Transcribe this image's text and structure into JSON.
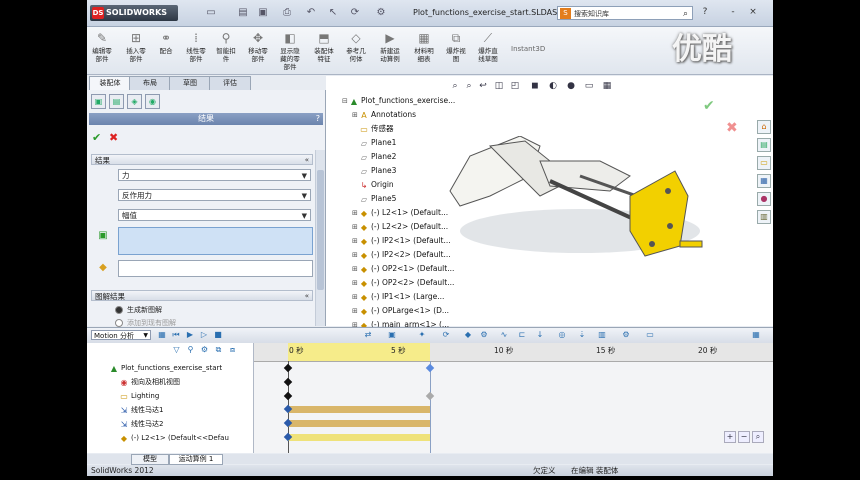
{
  "titlebar": {
    "logo": "SOLIDWORKS",
    "doc_title": "Plot_functions_exercise_start.SLDASM *",
    "search_placeholder": "搜索知识库",
    "help": "?",
    "minimize": "-",
    "close": "×"
  },
  "ribbon": {
    "items": [
      {
        "label": "编辑零部件",
        "icon": "edit-part-icon"
      },
      {
        "label": "插入零部件",
        "icon": "insert-part-icon"
      },
      {
        "label": "配合",
        "icon": "mate-icon"
      },
      {
        "label": "线性零部件",
        "icon": "linear-pattern-icon"
      },
      {
        "label": "智能扣件",
        "icon": "smart-fastener-icon"
      },
      {
        "label": "移动零部件",
        "icon": "move-part-icon"
      },
      {
        "label": "显示隐藏的零部件",
        "icon": "show-hidden-icon"
      },
      {
        "label": "装配体特征",
        "icon": "assembly-feature-icon"
      },
      {
        "label": "参考几何体",
        "icon": "reference-geometry-icon"
      },
      {
        "label": "新建运动算例",
        "icon": "new-motion-study-icon"
      },
      {
        "label": "材料明细表",
        "icon": "bom-icon"
      },
      {
        "label": "爆炸视图",
        "icon": "exploded-view-icon"
      },
      {
        "label": "爆炸直线草图",
        "icon": "explode-line-icon"
      }
    ],
    "instant3d": "Instant3D"
  },
  "watermark": "优酷",
  "tabs": [
    "装配体",
    "布局",
    "草图",
    "评估"
  ],
  "property_manager": {
    "title": "结果",
    "help": "?",
    "group1": "结果",
    "dropdown1": "力",
    "dropdown2": "反作用力",
    "dropdown3": "幅值",
    "group2": "图解结果",
    "radio1": "生成新图解",
    "radio2": "添加到现有图解"
  },
  "tree": {
    "root": "Plot_functions_exercise...",
    "items": [
      "Annotations",
      "传感器",
      "Plane1",
      "Plane2",
      "Plane3",
      "Origin",
      "Plane5",
      "(-) L2<1> (Default...",
      "(-) L2<2> (Default...",
      "(-) IP2<1> (Default...",
      "(-) IP2<2> (Default...",
      "(-) OP2<1> (Default...",
      "(-) OP2<2> (Default...",
      "(-) IP1<1> (Large...",
      "(-) OPLarge<1> (D...",
      "(-) main_arm<1> (..."
    ]
  },
  "motion": {
    "study_type": "Motion 分析",
    "tree": [
      "Plot_functions_exercise_start",
      "视向及相机视图",
      "Lighting",
      "线性马达1",
      "线性马达2",
      "(-) L2<1> (Default<<Defau"
    ],
    "ticks": [
      "0 秒",
      "5 秒",
      "10 秒",
      "15 秒",
      "20 秒"
    ]
  },
  "bottom_tabs": [
    "模型",
    "运动算例 1"
  ],
  "status": {
    "app": "SolidWorks 2012",
    "state": "欠定义",
    "mode": "在编辑 装配体"
  },
  "colors": {
    "ribbon_bg": "#e0e6ee",
    "pm_title": "#6b84ad",
    "timeline_highlight": "#f6ec8a",
    "bar": "#d9b66a",
    "model_yellow": "#f2d000"
  }
}
